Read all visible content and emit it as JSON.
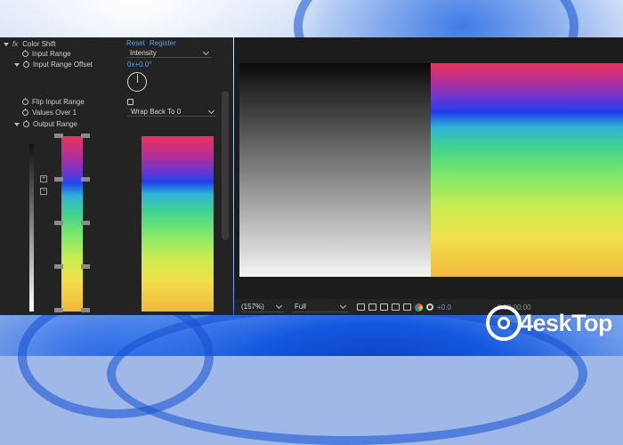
{
  "effect_controls": {
    "effect_prefix": "fx",
    "effect_name": "Color Shift",
    "reset_label": "Reset",
    "register_label": "Register",
    "input_range_label": "Input Range",
    "input_range_value": "Intensity",
    "input_range_offset_label": "Input Range Offset",
    "input_range_offset_value": "0x+0.0°",
    "flip_input_range_label": "Flip Input Range",
    "flip_input_range_checked": false,
    "values_over_1_label": "Values Over 1",
    "values_over_1_value": "Wrap Back To 0",
    "output_range_label": "Output Range",
    "add_button_label": "+",
    "remove_button_label": "−"
  },
  "viewer_bar": {
    "zoom_value": "(157%)",
    "resolution_value": "Full",
    "exposure_value": "+0.0",
    "timecode": "0:00:00:00"
  },
  "watermark": {
    "text": "4eskTop"
  },
  "colors": {
    "link": "#5b9df2",
    "panel_bg": "#232323",
    "viewer_bg": "#1c1c1c"
  }
}
